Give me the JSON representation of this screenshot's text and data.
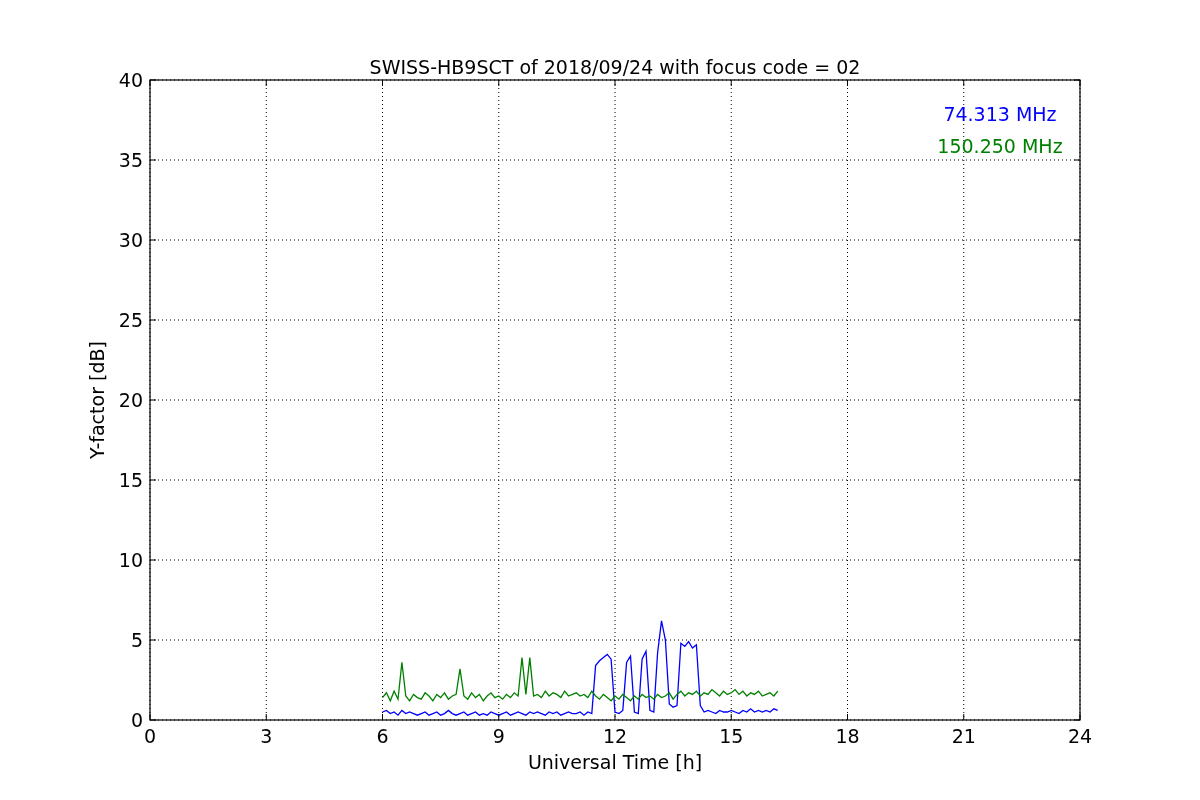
{
  "figure": {
    "chart_data": {
      "type": "line",
      "title": "SWISS-HB9SCT of 2018/09/24 with focus code = 02",
      "xlabel": "Universal Time [h]",
      "ylabel": "Y-factor [dB]",
      "x": [
        6.0,
        6.1,
        6.2,
        6.3,
        6.4,
        6.5,
        6.6,
        6.7,
        6.8,
        6.9,
        7.0,
        7.1,
        7.2,
        7.3,
        7.4,
        7.5,
        7.6,
        7.7,
        7.8,
        7.9,
        8.0,
        8.1,
        8.2,
        8.3,
        8.4,
        8.5,
        8.6,
        8.7,
        8.8,
        8.9,
        9.0,
        9.1,
        9.2,
        9.3,
        9.4,
        9.5,
        9.6,
        9.7,
        9.8,
        9.9,
        10.0,
        10.1,
        10.2,
        10.3,
        10.4,
        10.5,
        10.6,
        10.7,
        10.8,
        10.9,
        11.0,
        11.1,
        11.2,
        11.3,
        11.4,
        11.5,
        11.6,
        11.7,
        11.8,
        11.9,
        12.0,
        12.1,
        12.2,
        12.3,
        12.4,
        12.5,
        12.6,
        12.7,
        12.8,
        12.9,
        13.0,
        13.1,
        13.2,
        13.3,
        13.4,
        13.5,
        13.6,
        13.7,
        13.8,
        13.9,
        14.0,
        14.1,
        14.2,
        14.3,
        14.4,
        14.5,
        14.6,
        14.7,
        14.8,
        14.9,
        15.0,
        15.1,
        15.2,
        15.3,
        15.4,
        15.5,
        15.6,
        15.7,
        15.8,
        15.9,
        16.0,
        16.1,
        16.2
      ],
      "series": [
        {
          "name": "74.313 MHz",
          "color": "#0000ff",
          "values": [
            0.5,
            0.6,
            0.4,
            0.5,
            0.3,
            0.6,
            0.4,
            0.5,
            0.4,
            0.3,
            0.4,
            0.5,
            0.3,
            0.4,
            0.5,
            0.3,
            0.4,
            0.6,
            0.4,
            0.3,
            0.4,
            0.5,
            0.3,
            0.4,
            0.5,
            0.3,
            0.4,
            0.3,
            0.5,
            0.4,
            0.3,
            0.4,
            0.5,
            0.3,
            0.4,
            0.5,
            0.4,
            0.3,
            0.5,
            0.4,
            0.5,
            0.4,
            0.3,
            0.5,
            0.4,
            0.5,
            0.3,
            0.4,
            0.5,
            0.4,
            0.4,
            0.5,
            0.3,
            0.5,
            0.4,
            3.4,
            3.7,
            3.9,
            4.1,
            3.8,
            0.5,
            0.4,
            0.6,
            3.6,
            4.0,
            0.5,
            0.4,
            3.8,
            4.3,
            0.6,
            0.5,
            4.2,
            6.2,
            5.0,
            1.0,
            0.8,
            0.9,
            4.8,
            4.6,
            4.9,
            4.5,
            4.7,
            0.9,
            0.5,
            0.6,
            0.5,
            0.4,
            0.6,
            0.5,
            0.5,
            0.6,
            0.5,
            0.4,
            0.6,
            0.5,
            0.7,
            0.5,
            0.6,
            0.5,
            0.6,
            0.5,
            0.7,
            0.6
          ]
        },
        {
          "name": "150.250 MHz",
          "color": "#008000",
          "values": [
            1.4,
            1.7,
            1.2,
            1.8,
            1.3,
            3.6,
            1.5,
            1.2,
            1.6,
            1.4,
            1.3,
            1.7,
            1.5,
            1.2,
            1.6,
            1.4,
            1.7,
            1.3,
            1.5,
            1.6,
            3.2,
            1.5,
            1.3,
            1.7,
            1.4,
            1.6,
            1.2,
            1.5,
            1.7,
            1.4,
            1.5,
            1.3,
            1.6,
            1.4,
            1.7,
            1.5,
            3.9,
            1.6,
            3.9,
            1.5,
            1.6,
            1.4,
            1.8,
            1.5,
            1.7,
            1.6,
            1.4,
            1.8,
            1.5,
            1.6,
            1.7,
            1.5,
            1.6,
            1.4,
            1.8,
            1.5,
            1.3,
            1.6,
            1.4,
            1.2,
            1.5,
            1.3,
            1.6,
            1.4,
            1.2,
            1.5,
            1.3,
            1.6,
            1.4,
            1.5,
            1.3,
            1.6,
            1.4,
            1.5,
            1.7,
            1.3,
            1.6,
            1.8,
            1.5,
            1.7,
            1.6,
            1.8,
            1.5,
            1.7,
            1.6,
            1.9,
            1.7,
            1.5,
            1.8,
            1.6,
            1.7,
            1.9,
            1.6,
            1.8,
            1.5,
            1.7,
            1.6,
            1.8,
            1.5,
            1.6,
            1.7,
            1.5,
            1.8
          ]
        }
      ],
      "grid": true,
      "xlim": [
        0,
        24
      ],
      "ylim": [
        0,
        40
      ],
      "xticks": [
        0,
        3,
        6,
        9,
        12,
        15,
        18,
        21,
        24
      ],
      "yticks": [
        0,
        5,
        10,
        15,
        20,
        25,
        30,
        35,
        40
      ]
    }
  }
}
